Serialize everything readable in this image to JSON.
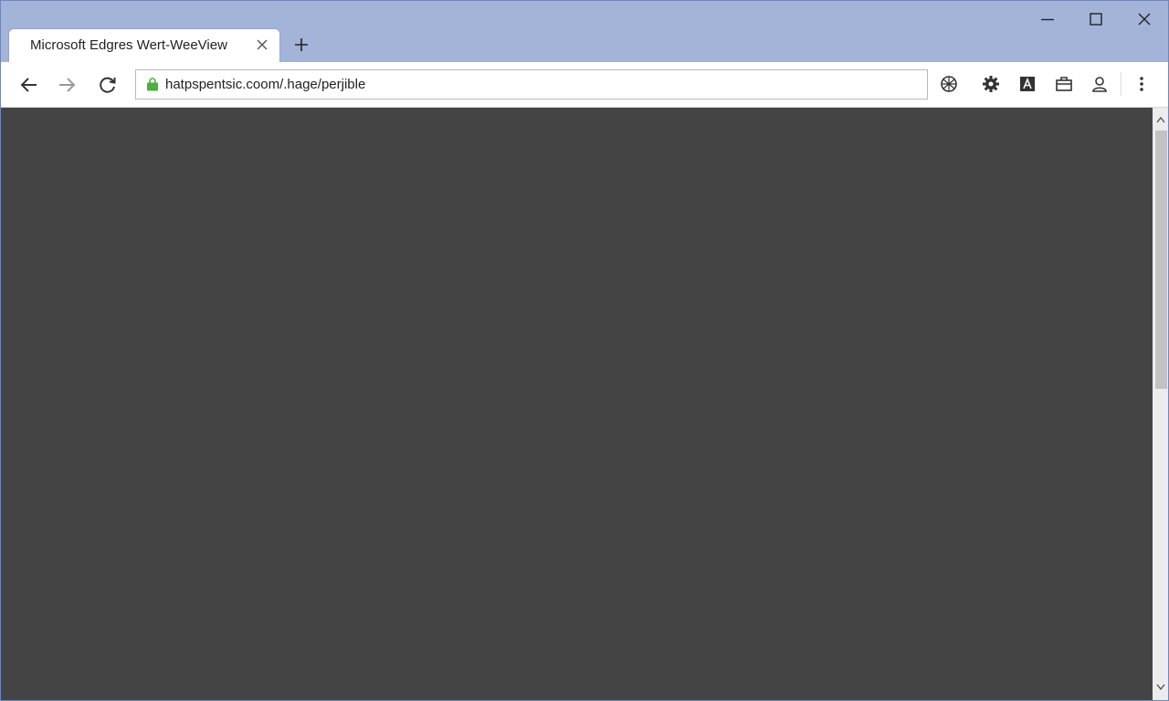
{
  "window": {
    "tab_title": "Microsoft Edgres Wert-WeeView",
    "controls": [
      "minimize-icon",
      "maximize-icon",
      "close-icon"
    ]
  },
  "toolbar": {
    "url": "hatpspentsic.coom/.hage/perjible",
    "icons": [
      "back-arrow-icon",
      "forward-arrow-icon",
      "reload-icon",
      "lock-icon",
      "globe-icon",
      "gear-icon",
      "reading-icon",
      "briefcase-icon",
      "account-icon",
      "more-menu-icon"
    ]
  },
  "colors": {
    "titlebar": "#a4b3d8",
    "viewport": "#444444",
    "lock": "#4caf3f"
  }
}
